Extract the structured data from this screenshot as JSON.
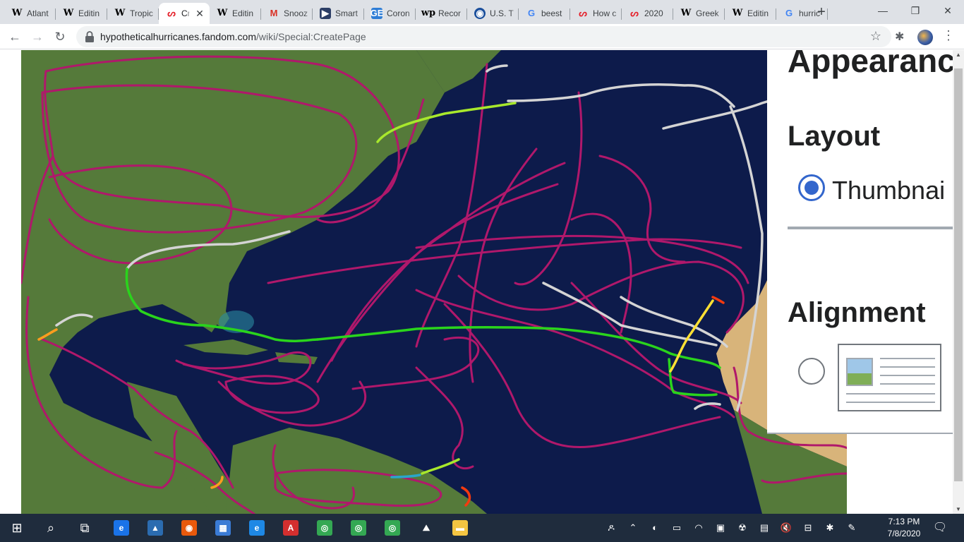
{
  "browser": {
    "tabs": [
      {
        "title": "Atlant",
        "icon": "wikipedia-icon"
      },
      {
        "title": "Editin",
        "icon": "wikipedia-icon"
      },
      {
        "title": "Tropic",
        "icon": "wikipedia-icon"
      },
      {
        "title": "Cr",
        "icon": "hypothetical-hurricanes-icon",
        "active": true
      },
      {
        "title": "Editin",
        "icon": "wikipedia-icon"
      },
      {
        "title": "Snooz",
        "icon": "gmail-icon"
      },
      {
        "title": "Smart",
        "icon": "smart-icon"
      },
      {
        "title": "Coron",
        "icon": "google-sheets-icon"
      },
      {
        "title": "Recor",
        "icon": "washington-post-icon"
      },
      {
        "title": "U.S. T",
        "icon": "noaa-icon"
      },
      {
        "title": "beest",
        "icon": "google-icon"
      },
      {
        "title": "How c",
        "icon": "hypothetical-hurricanes-icon"
      },
      {
        "title": "2020",
        "icon": "hypothetical-hurricanes-icon"
      },
      {
        "title": "Greek",
        "icon": "wikipedia-icon"
      },
      {
        "title": "Editin",
        "icon": "wikipedia-icon"
      },
      {
        "title": "hurric",
        "icon": "google-icon"
      }
    ],
    "tab_icon_glyphs": {
      "wikipedia-icon": "W",
      "hypothetical-hurricanes-icon": "ᔕ",
      "gmail-icon": "M",
      "smart-icon": "▶",
      "google-sheets-icon": "GE",
      "washington-post-icon": "wp",
      "noaa-icon": "◉",
      "google-icon": "G"
    },
    "close_glyph": "✕",
    "new_tab_glyph": "+",
    "window_controls": {
      "minimize": "—",
      "restore": "❐",
      "close": "✕"
    },
    "nav": {
      "back": "←",
      "forward": "→",
      "reload": "↻"
    },
    "url_host": "hypotheticalhurricanes.fandom.com",
    "url_path": "/wiki/Special:CreatePage",
    "star_glyph": "☆",
    "extensions_glyph": "✱",
    "menu_glyph": "⋮"
  },
  "panel": {
    "appearance_heading": "Appearanc",
    "layout_heading": "Layout",
    "thumbnail_label": "Thumbnai",
    "alignment_heading": "Alignment"
  },
  "map": {
    "colors": {
      "ocean": "#0d1b4b",
      "land": "#557a3a",
      "desert": "#d8b47a",
      "track_extratropical": "#b0186b",
      "track_depression": "#d4d4d4",
      "track_storm": "#2ad41c",
      "track_storm_light": "#a8e82c",
      "track_cat1": "#ffe033",
      "track_cat2": "#ff9d1e",
      "track_cat3": "#f43a0f",
      "track_subtropical": "#2aa6c9"
    }
  },
  "scrollbar": {
    "up": "▲",
    "down": "▼"
  },
  "taskbar": {
    "start_glyph": "⊞",
    "search_glyph": "⌕",
    "taskview_glyph": "⧉",
    "apps": [
      {
        "name": "edge-icon",
        "glyph": "e",
        "color": "#1a73e8"
      },
      {
        "name": "photos-icon",
        "glyph": "▲",
        "color": "#2b6cb0"
      },
      {
        "name": "firefox-icon",
        "glyph": "◉",
        "color": "#e8590c"
      },
      {
        "name": "store-icon",
        "glyph": "▦",
        "color": "#3a7bd5"
      },
      {
        "name": "internet-explorer-icon",
        "glyph": "e",
        "color": "#1e88e5"
      },
      {
        "name": "acrobat-icon",
        "glyph": "A",
        "color": "#d32f2f"
      },
      {
        "name": "chrome-icon",
        "glyph": "◎",
        "color": "#34a853"
      },
      {
        "name": "chrome-profile-icon",
        "glyph": "◎",
        "color": "#34a853"
      },
      {
        "name": "chrome-app-icon",
        "glyph": "◎",
        "color": "#34a853"
      },
      {
        "name": "mountain-app-icon",
        "glyph": "⛰",
        "color": "#1f2c3d"
      },
      {
        "name": "file-explorer-icon",
        "glyph": "▬",
        "color": "#f4c542"
      }
    ],
    "tray_glyphs": [
      "ዶ",
      "⌃",
      "◐",
      "▭",
      "◠",
      "▣",
      "☢",
      "▤",
      "🔇",
      "⊟",
      "✱",
      "✎"
    ],
    "clock_time": "7:13 PM",
    "clock_date": "7/8/2020",
    "notification_glyph": "🗨"
  }
}
